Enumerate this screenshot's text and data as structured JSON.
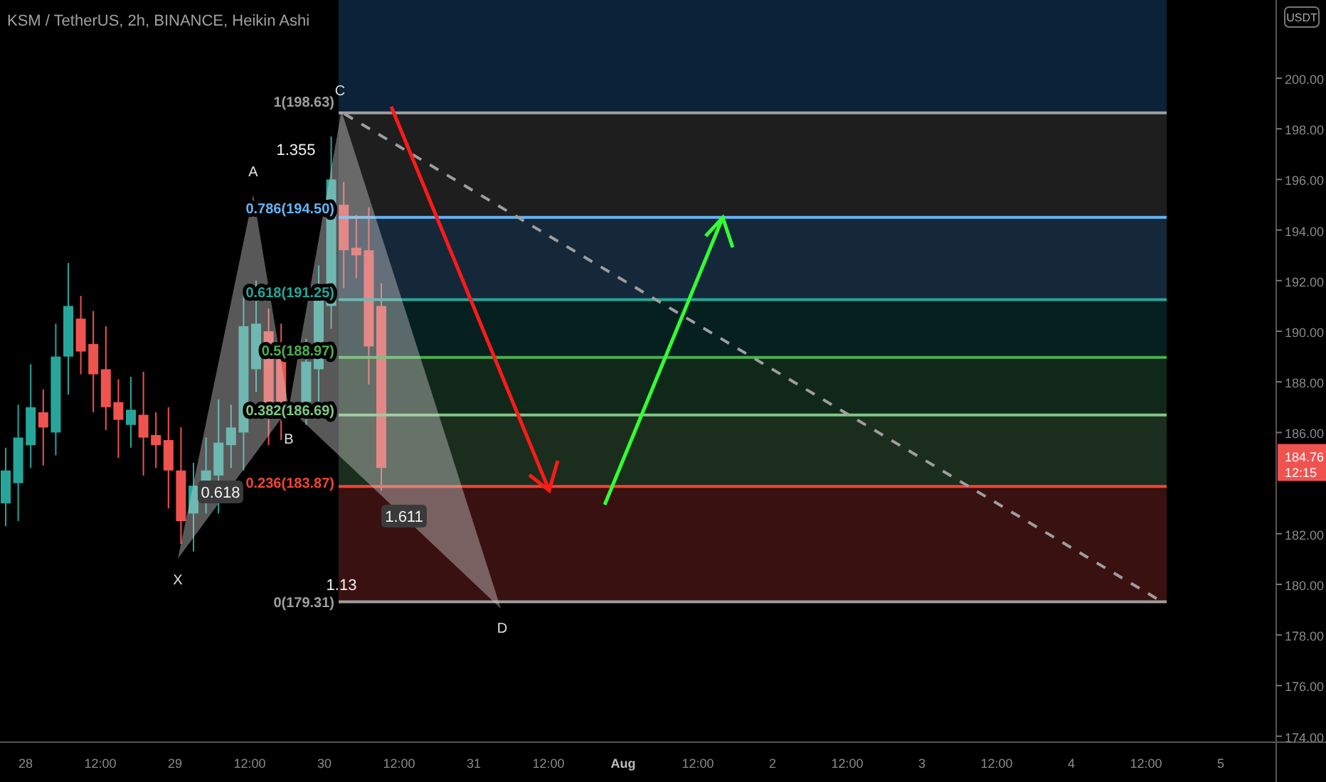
{
  "chart_title": "KSM / TetherUS, 2h, BINANCE, Heikin Ashi",
  "currency_badge": "USDT",
  "price_axis": [
    {
      "label": "200.00"
    },
    {
      "label": "198.00"
    },
    {
      "label": "196.00"
    },
    {
      "label": "194.00"
    },
    {
      "label": "192.00"
    },
    {
      "label": "190.00"
    },
    {
      "label": "188.00"
    },
    {
      "label": "186.00"
    },
    {
      "label": "182.00"
    },
    {
      "label": "180.00"
    },
    {
      "label": "178.00"
    },
    {
      "label": "176.00"
    },
    {
      "label": "174.00"
    }
  ],
  "last_price": {
    "price_label": "184.76",
    "countdown": "12:15"
  },
  "time_axis": [
    {
      "label": "28",
      "bold": false
    },
    {
      "label": "12:00",
      "bold": false
    },
    {
      "label": "29",
      "bold": false
    },
    {
      "label": "12:00",
      "bold": false
    },
    {
      "label": "30",
      "bold": false
    },
    {
      "label": "12:00",
      "bold": false
    },
    {
      "label": "31",
      "bold": false
    },
    {
      "label": "12:00",
      "bold": false
    },
    {
      "label": "Aug",
      "bold": true
    },
    {
      "label": "12:00",
      "bold": false
    },
    {
      "label": "2",
      "bold": false
    },
    {
      "label": "12:00",
      "bold": false
    },
    {
      "label": "3",
      "bold": false
    },
    {
      "label": "12:00",
      "bold": false
    },
    {
      "label": "4",
      "bold": false
    },
    {
      "label": "12:00",
      "bold": false
    },
    {
      "label": "5",
      "bold": false
    }
  ],
  "fib_levels": [
    {
      "label": "1(198.63)",
      "color": "#9e9e9e"
    },
    {
      "label": "0.786(194.50)",
      "color": "#64b5f6"
    },
    {
      "label": "0.618(191.25)",
      "color": "#26a69a"
    },
    {
      "label": "0.5(188.97)",
      "color": "#4caf50"
    },
    {
      "label": "0.382(186.69)",
      "color": "#81c784"
    },
    {
      "label": "0.236(183.87)",
      "color": "#f44336"
    },
    {
      "label": "0(179.31)",
      "color": "#9e9e9e"
    }
  ],
  "pattern_points": [
    {
      "label": "X"
    },
    {
      "label": "A"
    },
    {
      "label": "B"
    },
    {
      "label": "C"
    },
    {
      "label": "D"
    }
  ],
  "pattern_ratios": [
    {
      "label": "1.355",
      "boxed": false
    },
    {
      "label": "0.618",
      "boxed": true
    },
    {
      "label": "1.611",
      "boxed": true
    },
    {
      "label": "1.13",
      "boxed": false
    }
  ]
}
